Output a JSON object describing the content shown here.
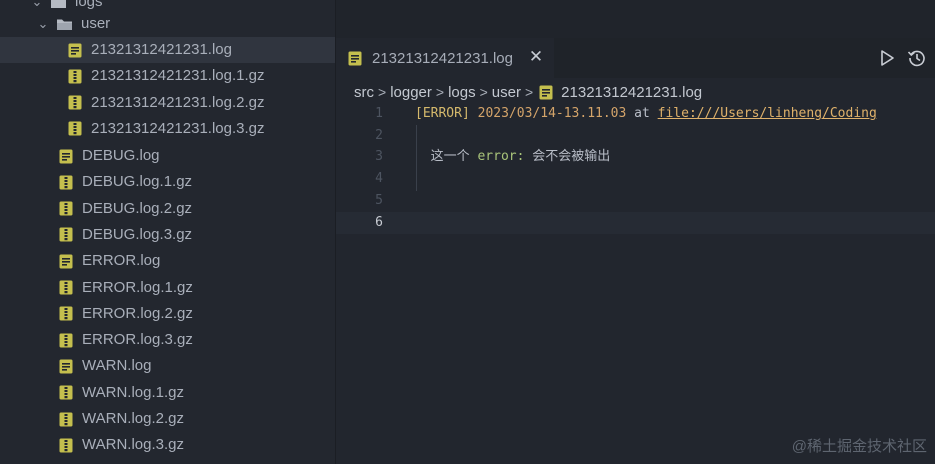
{
  "explorer": {
    "root_folder": "logs",
    "subfolder": "user",
    "user_files": [
      "21321312421231.log",
      "21321312421231.log.1.gz",
      "21321312421231.log.2.gz",
      "21321312421231.log.3.gz"
    ],
    "log_files": [
      "DEBUG.log",
      "DEBUG.log.1.gz",
      "DEBUG.log.2.gz",
      "DEBUG.log.3.gz",
      "ERROR.log",
      "ERROR.log.1.gz",
      "ERROR.log.2.gz",
      "ERROR.log.3.gz",
      "WARN.log",
      "WARN.log.1.gz",
      "WARN.log.2.gz",
      "WARN.log.3.gz"
    ],
    "selected_file": "21321312421231.log"
  },
  "editor": {
    "tab": {
      "label": "21321312421231.log",
      "close": "✕"
    },
    "breadcrumb": [
      "src",
      "logger",
      "logs",
      "user",
      "21321312421231.log"
    ],
    "lines": [
      {
        "num": "1",
        "tokens": [
          {
            "type": "err",
            "text": "[ERROR]"
          },
          {
            "type": "plain",
            "text": " "
          },
          {
            "type": "date",
            "text": "2023/03/14-13.11.03"
          },
          {
            "type": "at",
            "text": " at "
          },
          {
            "type": "link",
            "text": "file:///Users/linheng/Coding"
          }
        ]
      },
      {
        "num": "2",
        "tokens": []
      },
      {
        "num": "3",
        "tokens": [
          {
            "type": "plain",
            "text": "  这一个 "
          },
          {
            "type": "kw",
            "text": "error:"
          },
          {
            "type": "plain",
            "text": " 会不会被输出"
          }
        ]
      },
      {
        "num": "4",
        "tokens": []
      },
      {
        "num": "5",
        "tokens": []
      },
      {
        "num": "6",
        "tokens": []
      }
    ],
    "current_line": 6
  },
  "icons": {
    "run": "play-icon",
    "history": "history-icon",
    "file": "log-file-icon",
    "archive": "zip-file-icon",
    "folder": "folder-open-icon"
  },
  "colors": {
    "file_icon": "#c4bf4e",
    "sidebar_bg": "#23272f",
    "editor_bg": "#22262e",
    "selected_row": "#30353f"
  },
  "watermark": "@稀土掘金技术社区"
}
